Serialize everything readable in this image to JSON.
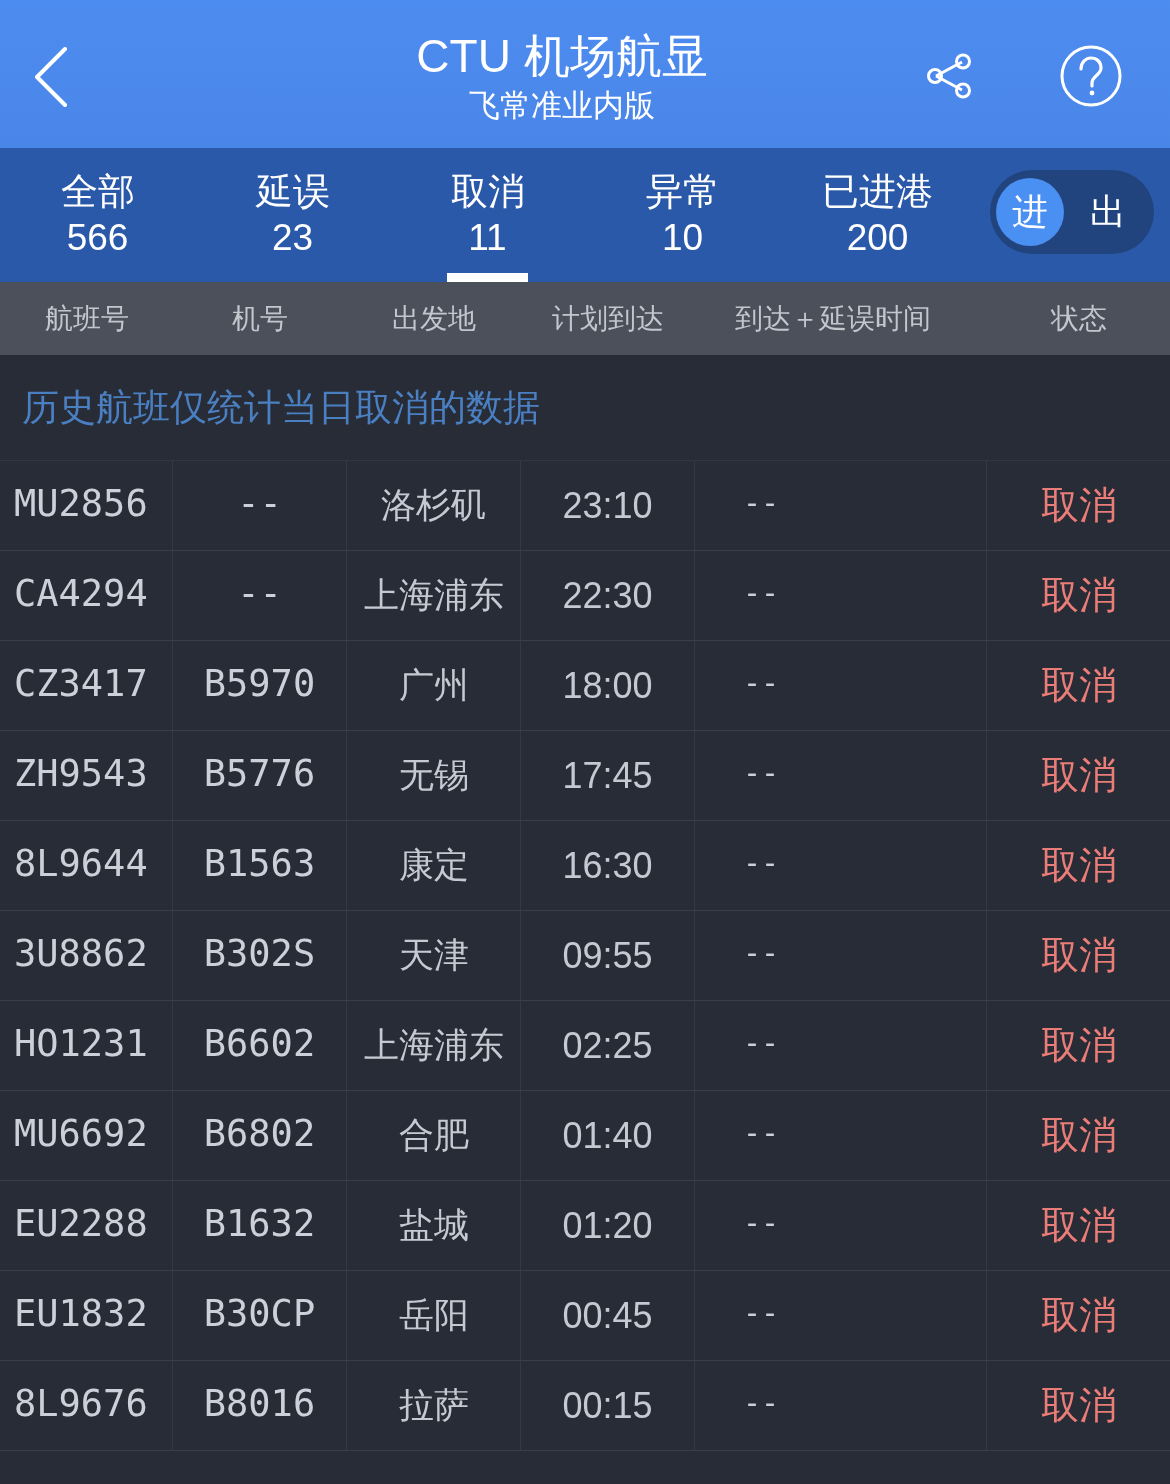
{
  "header": {
    "title": "CTU 机场航显",
    "subtitle": "飞常准业内版"
  },
  "tabs": [
    {
      "label": "全部",
      "count": "566",
      "selected": false
    },
    {
      "label": "延误",
      "count": "23",
      "selected": false
    },
    {
      "label": "取消",
      "count": "11",
      "selected": true
    },
    {
      "label": "异常",
      "count": "10",
      "selected": false
    },
    {
      "label": "已进港",
      "count": "200",
      "selected": false
    }
  ],
  "direction_toggle": [
    {
      "label": "进",
      "selected": true
    },
    {
      "label": "出",
      "selected": false
    }
  ],
  "table": {
    "columns": [
      "航班号",
      "机号",
      "出发地",
      "计划到达",
      "到达＋延误时间",
      "状态"
    ],
    "note": "历史航班仅统计当日取消的数据",
    "rows": [
      {
        "flight": "MU2856",
        "aircraft": "--",
        "origin": "洛杉矶",
        "scheduled_arrival": "23:10",
        "arrival_delay": "--",
        "status": "取消"
      },
      {
        "flight": "CA4294",
        "aircraft": "--",
        "origin": "上海浦东",
        "scheduled_arrival": "22:30",
        "arrival_delay": "--",
        "status": "取消"
      },
      {
        "flight": "CZ3417",
        "aircraft": "B5970",
        "origin": "广州",
        "scheduled_arrival": "18:00",
        "arrival_delay": "--",
        "status": "取消"
      },
      {
        "flight": "ZH9543",
        "aircraft": "B5776",
        "origin": "无锡",
        "scheduled_arrival": "17:45",
        "arrival_delay": "--",
        "status": "取消"
      },
      {
        "flight": "8L9644",
        "aircraft": "B1563",
        "origin": "康定",
        "scheduled_arrival": "16:30",
        "arrival_delay": "--",
        "status": "取消"
      },
      {
        "flight": "3U8862",
        "aircraft": "B302S",
        "origin": "天津",
        "scheduled_arrival": "09:55",
        "arrival_delay": "--",
        "status": "取消"
      },
      {
        "flight": "HO1231",
        "aircraft": "B6602",
        "origin": "上海浦东",
        "scheduled_arrival": "02:25",
        "arrival_delay": "--",
        "status": "取消"
      },
      {
        "flight": "MU6692",
        "aircraft": "B6802",
        "origin": "合肥",
        "scheduled_arrival": "01:40",
        "arrival_delay": "--",
        "status": "取消"
      },
      {
        "flight": "EU2288",
        "aircraft": "B1632",
        "origin": "盐城",
        "scheduled_arrival": "01:20",
        "arrival_delay": "--",
        "status": "取消"
      },
      {
        "flight": "EU1832",
        "aircraft": "B30CP",
        "origin": "岳阳",
        "scheduled_arrival": "00:45",
        "arrival_delay": "--",
        "status": "取消"
      },
      {
        "flight": "8L9676",
        "aircraft": "B8016",
        "origin": "拉萨",
        "scheduled_arrival": "00:15",
        "arrival_delay": "--",
        "status": "取消"
      }
    ]
  }
}
